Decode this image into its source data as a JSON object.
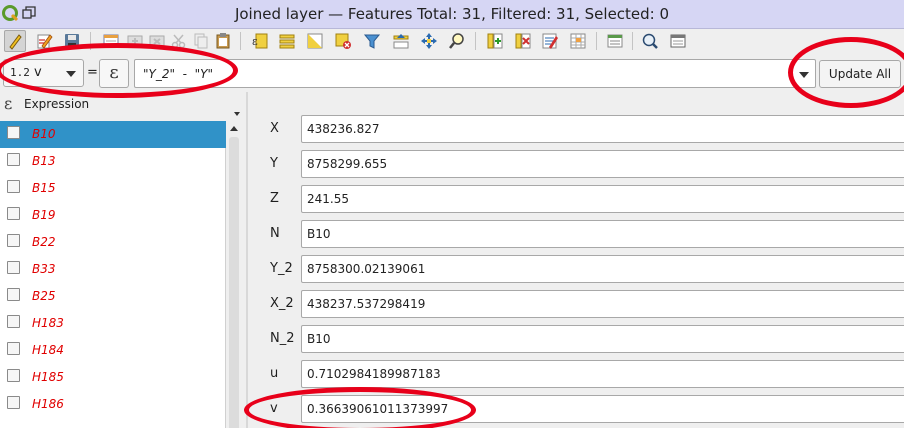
{
  "window": {
    "title": "Joined layer — Features Total: 31, Filtered: 31, Selected: 0"
  },
  "toolbar": {
    "buttons": [
      {
        "name": "toggle-editing-button",
        "icon": "pencil-icon"
      },
      {
        "name": "multi-edit-button",
        "icon": "multi-edit-icon"
      },
      {
        "name": "save-edits-button",
        "icon": "save-icon"
      },
      {
        "name": "reload-button",
        "icon": "reload-icon"
      },
      {
        "name": "add-feature-button",
        "icon": "add-feature-icon"
      },
      {
        "name": "delete-feature-button",
        "icon": "delete-icon"
      },
      {
        "name": "cut-button",
        "icon": "cut-icon"
      },
      {
        "name": "copy-button",
        "icon": "copy-icon"
      },
      {
        "name": "paste-button",
        "icon": "paste-icon"
      },
      {
        "name": "select-expression-button",
        "icon": "select-expression-icon"
      },
      {
        "name": "select-all-button",
        "icon": "select-all-icon"
      },
      {
        "name": "invert-selection-button",
        "icon": "invert-selection-icon"
      },
      {
        "name": "deselect-button",
        "icon": "deselect-icon"
      },
      {
        "name": "filter-button",
        "icon": "filter-icon"
      },
      {
        "name": "move-selection-top-button",
        "icon": "move-top-icon"
      },
      {
        "name": "pan-to-selection-button",
        "icon": "pan-icon"
      },
      {
        "name": "zoom-to-selection-button",
        "icon": "zoom-icon"
      },
      {
        "name": "new-field-button",
        "icon": "new-field-icon"
      },
      {
        "name": "delete-field-button",
        "icon": "delete-field-icon"
      },
      {
        "name": "field-calculator-button",
        "icon": "field-calculator-icon"
      },
      {
        "name": "conditional-formatting-button",
        "icon": "conditional-formatting-icon"
      },
      {
        "name": "actions-button",
        "icon": "actions-icon"
      },
      {
        "name": "zoom-map-button",
        "icon": "magnifier-icon"
      },
      {
        "name": "dock-button",
        "icon": "dock-icon"
      }
    ]
  },
  "calcbar": {
    "field_type": "1.2",
    "field_name": "v",
    "equals": "=",
    "epsilon": "ε",
    "expression": "\"Y_2\"  -  \"Y\"",
    "update_all": "Update All"
  },
  "left_panel": {
    "header_icon": "ε",
    "header_label": "Expression",
    "rows": [
      "B10",
      "B13",
      "B15",
      "B19",
      "B22",
      "B33",
      "B25",
      "H183",
      "H184",
      "H185",
      "H186"
    ],
    "selected_index": 0
  },
  "form": {
    "fields": [
      {
        "label": "X",
        "value": "438236.827"
      },
      {
        "label": "Y",
        "value": "8758299.655"
      },
      {
        "label": "Z",
        "value": "241.55"
      },
      {
        "label": "N",
        "value": "B10"
      },
      {
        "label": "Y_2",
        "value": "8758300.02139061"
      },
      {
        "label": "X_2",
        "value": "438237.537298419"
      },
      {
        "label": "N_2",
        "value": "B10"
      },
      {
        "label": "u",
        "value": "0.7102984189987183"
      },
      {
        "label": "v",
        "value": "0.36639061011373997"
      }
    ]
  },
  "colors": {
    "titlebar": "#d6d6f4",
    "selection": "#3092c8",
    "feature_text": "#e00000",
    "annotation": "#e8001a"
  }
}
